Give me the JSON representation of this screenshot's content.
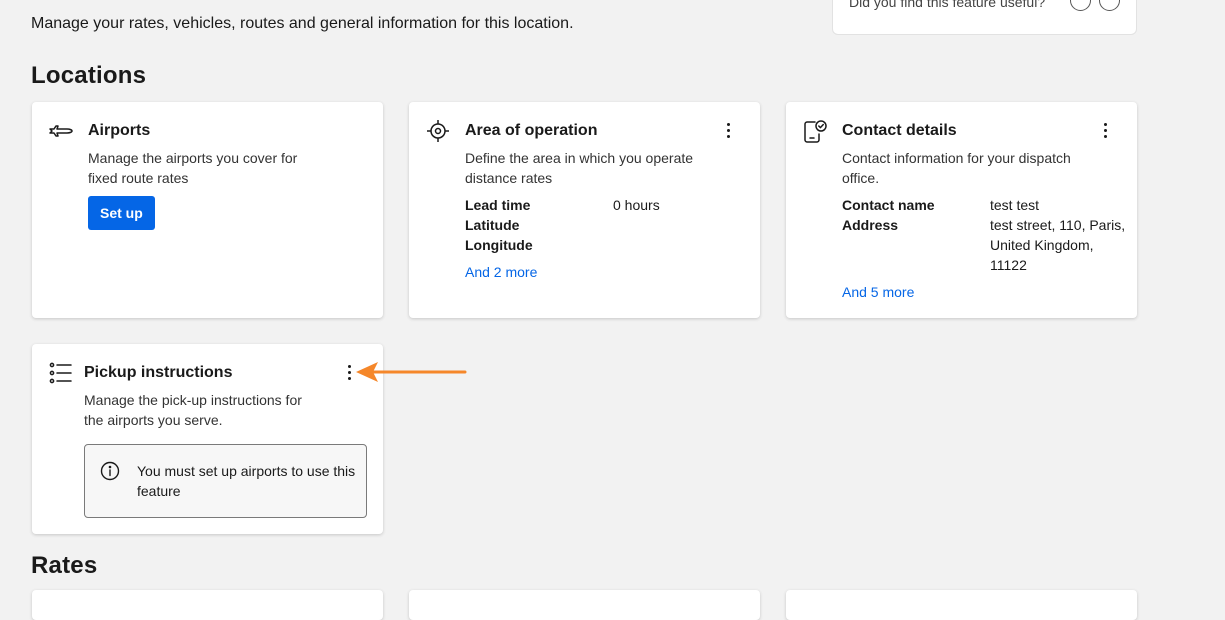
{
  "header": {
    "description": "Manage your rates, vehicles, routes and general information for this location."
  },
  "feedback": {
    "question": "Did you find this feature useful?"
  },
  "sections": {
    "locations_title": "Locations",
    "rates_title": "Rates"
  },
  "cards": {
    "airports": {
      "title": "Airports",
      "description": "Manage the airports you cover for fixed route rates",
      "button_label": "Set up",
      "icon": "airplane-icon"
    },
    "area": {
      "title": "Area of operation",
      "description": "Define the area in which you operate distance rates",
      "rows": [
        {
          "label": "Lead time",
          "value": "0 hours"
        },
        {
          "label": "Latitude",
          "value": ""
        },
        {
          "label": "Longitude",
          "value": ""
        }
      ],
      "more_link": "And 2 more",
      "icon": "crosshair-icon"
    },
    "contact": {
      "title": "Contact details",
      "description": "Contact information for your dispatch office.",
      "rows": [
        {
          "label": "Contact name",
          "value": "test test"
        },
        {
          "label": "Address",
          "value": "test street, 110, Paris, United Kingdom, 11122"
        }
      ],
      "more_link": "And 5 more",
      "icon": "phone-check-icon"
    },
    "pickup": {
      "title": "Pickup instructions",
      "description": "Manage the pick-up instructions for the airports you serve.",
      "notice": "You must set up airports to use this feature",
      "icon": "list-icon"
    }
  },
  "colors": {
    "primary": "#0566e6",
    "arrow": "#f5872a",
    "background": "#f2f2f2"
  }
}
